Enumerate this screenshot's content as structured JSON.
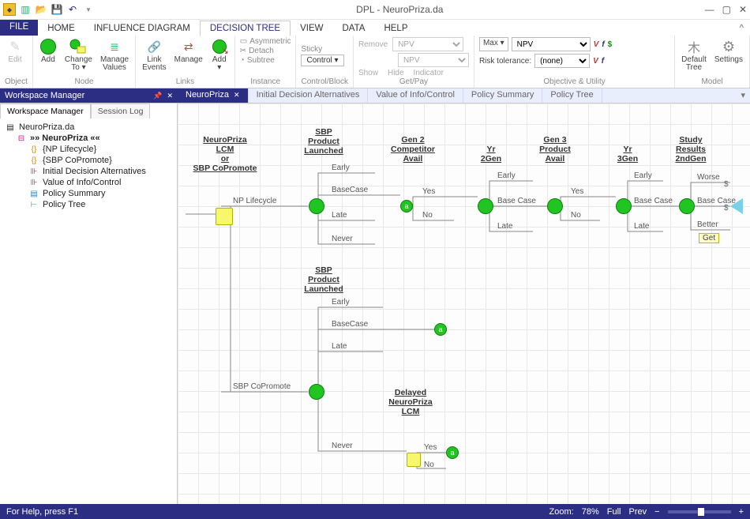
{
  "app": {
    "title": "DPL - NeuroPriza.da"
  },
  "qat": {
    "icons": [
      "app-icon",
      "new",
      "open",
      "save",
      "undo",
      "customize"
    ]
  },
  "ribbon_tabs": {
    "file": "FILE",
    "items": [
      "HOME",
      "INFLUENCE DIAGRAM",
      "DECISION TREE",
      "VIEW",
      "DATA",
      "HELP"
    ],
    "active_index": 2
  },
  "ribbon": {
    "object": {
      "edit": "Edit",
      "label": "Object"
    },
    "node": {
      "add": "Add",
      "change_to": "Change\nTo ▾",
      "manage_values": "Manage\nValues",
      "label": "Node"
    },
    "links": {
      "link_events": "Link\nEvents",
      "manage": "Manage",
      "add": "Add\n▾",
      "label": "Links"
    },
    "instance": {
      "asymmetric": "Asymmetric",
      "detach": "Detach",
      "subtree": "Subtree",
      "label": "Instance"
    },
    "control_block": {
      "sticky": "Sticky",
      "control": "Control ▾",
      "label": "Control/Block"
    },
    "getpay": {
      "remove": "Remove",
      "combo1": "NPV",
      "combo2": "NPV",
      "show": "Show",
      "hide": "Hide",
      "indicator": "Indicator",
      "label": "Get/Pay"
    },
    "obj_util": {
      "max_label": "Max ▾",
      "max_combo": "NPV",
      "risk_label": "Risk tolerance:",
      "risk_combo": "(none)",
      "symbols1": [
        "V",
        "f",
        "$"
      ],
      "symbols2": [
        "V",
        "f"
      ],
      "label": "Objective & Utility"
    },
    "model": {
      "default_tree": "Default\nTree",
      "settings": "Settings",
      "label": "Model"
    }
  },
  "workspace_header": "Workspace Manager",
  "doc_tabs": {
    "items": [
      "NeuroPriza",
      "Initial Decision Alternatives",
      "Value of Info/Control",
      "Policy Summary",
      "Policy Tree"
    ],
    "active_index": 0
  },
  "workspace_tabs": {
    "items": [
      "Workspace Manager",
      "Session Log"
    ],
    "active_index": 0
  },
  "tree": {
    "root": "NeuroPriza.da",
    "active": "»» NeuroPriza ««",
    "items": [
      "{NP Lifecycle}",
      "{SBP CoPromote}",
      "Initial Decision Alternatives",
      "Value of Info/Control",
      "Policy Summary",
      "Policy Tree"
    ]
  },
  "canvas": {
    "labels": {
      "neuropriza_decision": "NeuroPriza\nLCM\nor\nSBP CoPromote",
      "sbp_top": "SBP\nProduct\nLaunched",
      "sbp_bot": "SBP\nProduct\nLaunched",
      "gen2": "Gen 2\nCompetitor\nAvail",
      "yr2": "Yr\n2Gen",
      "gen3": "Gen 3\nProduct\nAvail",
      "yr3": "Yr\n3Gen",
      "study": "Study\nResults\n2ndGen",
      "delayed": "Delayed\nNeuroPriza\nLCM"
    },
    "branches": {
      "np_lifecycle": "NP Lifecycle",
      "sbp_copromote": "SBP CoPromote",
      "early": "Early",
      "basecase": "BaseCase",
      "late": "Late",
      "never": "Never",
      "yes": "Yes",
      "no": "No",
      "base_case_sp": "Base Case",
      "worse": "Worse",
      "better": "Better",
      "get": "Get"
    }
  },
  "status": {
    "help": "For Help, press F1",
    "zoom_label": "Zoom:",
    "zoom_value": "78%",
    "full": "Full",
    "prev": "Prev"
  }
}
